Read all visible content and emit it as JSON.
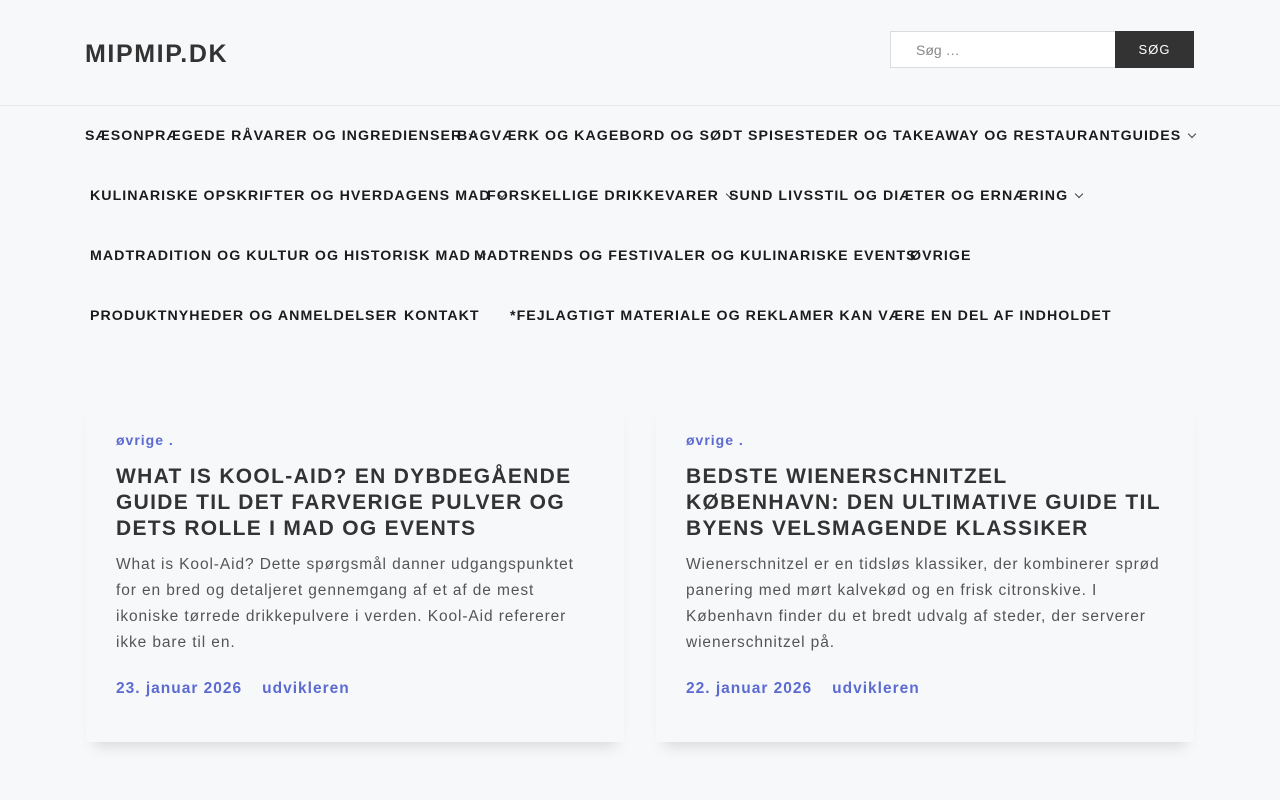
{
  "header": {
    "site_title": "MIPMIP.DK",
    "search_placeholder": "Søg …",
    "search_button": "SØG"
  },
  "nav": {
    "items": [
      {
        "label": "SÆSONPRÆGEDE RÅVARER OG INGREDIENSER",
        "has_submenu": true
      },
      {
        "label": "BAGVÆRK OG KAGEBORD OG SØDT",
        "has_submenu": false
      },
      {
        "label": "SPISESTEDER OG TAKEAWAY OG RESTAURANTGUIDES",
        "has_submenu": true
      },
      {
        "label": "KULINARISKE OPSKRIFTER OG HVERDAGENS MAD",
        "has_submenu": true
      },
      {
        "label": "FORSKELLIGE DRIKKEVARER",
        "has_submenu": true
      },
      {
        "label": "SUND LIVSSTIL OG DIÆTER OG ERNÆRING",
        "has_submenu": true
      },
      {
        "label": "MADTRADITION OG KULTUR OG HISTORISK MAD",
        "has_submenu": true
      },
      {
        "label": "MADTRENDS OG FESTIVALER OG KULINARISKE EVENTS",
        "has_submenu": false
      },
      {
        "label": "ØVRIGE",
        "has_submenu": false
      },
      {
        "label": "PRODUKTNYHEDER OG ANMELDELSER",
        "has_submenu": false
      },
      {
        "label": "KONTAKT",
        "has_submenu": false
      },
      {
        "label": "*FEJLAGTIGT MATERIALE OG REKLAMER KAN VÆRE EN DEL AF INDHOLDET",
        "has_submenu": false
      }
    ]
  },
  "posts": [
    {
      "category": "øvrige .",
      "title": "WHAT IS KOOL-AID? EN DYBDEGÅENDE GUIDE TIL DET FARVERIGE PULVER OG DETS ROLLE I MAD OG EVENTS",
      "excerpt": "What is Kool-Aid? Dette spørgsmål danner udgangspunktet for en bred og detaljeret gennemgang af et af de mest ikoniske tørrede drikkepulvere i verden. Kool-Aid refererer ikke bare til en.",
      "date": "23. januar 2026",
      "author": "udvikleren"
    },
    {
      "category": "øvrige .",
      "title": "BEDSTE WIENERSCHNITZEL KØBENHAVN: DEN ULTIMATIVE GUIDE TIL BYENS VELSMAGENDE KLASSIKER",
      "excerpt": "Wienerschnitzel er en tidsløs klassiker, der kombinerer sprød panering med mørt kalvekød og en frisk citronskive. I København finder du et bredt udvalg af steder, der serverer wienerschnitzel på.",
      "date": "22. januar 2026",
      "author": "udvikleren"
    }
  ],
  "colors": {
    "accent": "#5c6bd0",
    "background": "#f7f8fa",
    "button": "#333333"
  }
}
